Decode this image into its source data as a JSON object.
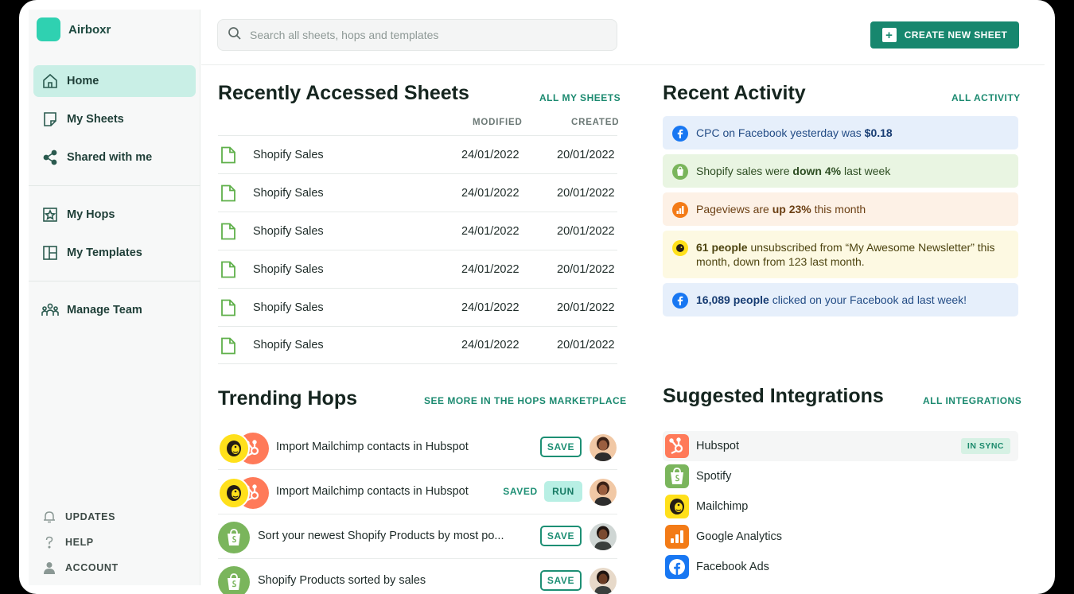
{
  "app": {
    "name": "Airboxr"
  },
  "sidebar": {
    "primary": [
      {
        "label": "Home",
        "icon": "home-icon"
      },
      {
        "label": "My Sheets",
        "icon": "sheet-icon"
      },
      {
        "label": "Shared with me",
        "icon": "share-icon"
      }
    ],
    "secondary": [
      {
        "label": "My Hops",
        "icon": "star-bookmark-icon"
      },
      {
        "label": "My Templates",
        "icon": "template-icon"
      }
    ],
    "tertiary": [
      {
        "label": "Manage Team",
        "icon": "team-icon"
      }
    ],
    "bottom": [
      {
        "label": "UPDATES",
        "icon": "bell-icon"
      },
      {
        "label": "HELP",
        "icon": "question-icon"
      },
      {
        "label": "ACCOUNT",
        "icon": "user-icon"
      }
    ]
  },
  "search": {
    "placeholder": "Search all sheets, hops and templates",
    "value": ""
  },
  "create_button": {
    "label": "CREATE NEW SHEET"
  },
  "sheets": {
    "title": "Recently Accessed Sheets",
    "link": "ALL MY SHEETS",
    "columns": {
      "modified": "MODIFIED",
      "created": "CREATED"
    },
    "rows": [
      {
        "name": "Shopify Sales",
        "modified": "24/01/2022",
        "created": "20/01/2022"
      },
      {
        "name": "Shopify Sales",
        "modified": "24/01/2022",
        "created": "20/01/2022"
      },
      {
        "name": "Shopify Sales",
        "modified": "24/01/2022",
        "created": "20/01/2022"
      },
      {
        "name": "Shopify Sales",
        "modified": "24/01/2022",
        "created": "20/01/2022"
      },
      {
        "name": "Shopify Sales",
        "modified": "24/01/2022",
        "created": "20/01/2022"
      },
      {
        "name": "Shopify Sales",
        "modified": "24/01/2022",
        "created": "20/01/2022"
      }
    ]
  },
  "activity": {
    "title": "Recent Activity",
    "link": "ALL ACTIVITY",
    "items": [
      {
        "kind": "facebook",
        "icon": "facebook-icon",
        "parts": [
          {
            "t": "CPC on Facebook yesterday was ",
            "b": false
          },
          {
            "t": "$0.18",
            "b": true
          }
        ]
      },
      {
        "kind": "shopify",
        "icon": "shopify-icon",
        "parts": [
          {
            "t": "Shopify sales were ",
            "b": false
          },
          {
            "t": "down 4%",
            "b": true
          },
          {
            "t": " last week",
            "b": false
          }
        ]
      },
      {
        "kind": "analytics",
        "icon": "google-analytics-icon",
        "parts": [
          {
            "t": "Pageviews are ",
            "b": false
          },
          {
            "t": "up 23%",
            "b": true
          },
          {
            "t": " this month",
            "b": false
          }
        ]
      },
      {
        "kind": "mailchimp",
        "icon": "mailchimp-icon",
        "parts": [
          {
            "t": "61 people",
            "b": true
          },
          {
            "t": " unsubscribed from “My Awesome Newsletter” this month, down from 123 last month.",
            "b": false
          }
        ]
      },
      {
        "kind": "facebook",
        "icon": "facebook-icon",
        "parts": [
          {
            "t": "16,089 people",
            "b": true
          },
          {
            "t": " clicked on your Facebook ad last week!",
            "b": false
          }
        ]
      }
    ]
  },
  "hops": {
    "title": "Trending Hops",
    "link": "SEE MORE IN THE HOPS MARKETPLACE",
    "items": [
      {
        "title": "Import Mailchimp contacts in Hubspot",
        "logos": [
          "mailchimp",
          "hubspot"
        ],
        "action": "SAVE",
        "saved_label": "",
        "avatar": "a"
      },
      {
        "title": "Import Mailchimp contacts in Hubspot",
        "logos": [
          "mailchimp",
          "hubspot"
        ],
        "action": "RUN",
        "saved_label": "SAVED",
        "avatar": "a"
      },
      {
        "title": "Sort your newest Shopify Products by most po...",
        "logos": [
          "shopify"
        ],
        "action": "SAVE",
        "saved_label": "",
        "avatar": "b"
      },
      {
        "title": "Shopify Products sorted by sales",
        "logos": [
          "shopify"
        ],
        "action": "SAVE",
        "saved_label": "",
        "avatar": "c"
      }
    ]
  },
  "integrations": {
    "title": "Suggested Integrations",
    "link": "ALL INTEGRATIONS",
    "items": [
      {
        "name": "Hubspot",
        "logo": "hubspot-icon",
        "badge": "IN SYNC"
      },
      {
        "name": "Spotify",
        "logo": "shopify-icon",
        "badge": ""
      },
      {
        "name": "Mailchimp",
        "logo": "mailchimp-icon",
        "badge": ""
      },
      {
        "name": "Google Analytics",
        "logo": "google-analytics-icon",
        "badge": ""
      },
      {
        "name": "Facebook Ads",
        "logo": "facebook-icon",
        "badge": ""
      }
    ]
  },
  "colors": {
    "brand": "#2fd1b1",
    "accent": "#17876e",
    "active_nav": "#c9efe6",
    "facebook": "#1877f2",
    "shopify": "#7ab55c",
    "analytics": "#f37b17",
    "mailchimp": "#ffe01b",
    "hubspot": "#ff7a59"
  }
}
